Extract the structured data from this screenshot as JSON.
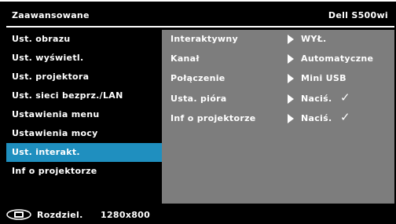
{
  "header": {
    "title": "Zaawansowane",
    "model": "Dell S500wi"
  },
  "sidebar": {
    "items": [
      {
        "label": "Ust. obrazu"
      },
      {
        "label": "Ust. wyświetl."
      },
      {
        "label": "Ust. projektora"
      },
      {
        "label": "Ust. sieci bezprz./LAN"
      },
      {
        "label": "Ustawienia menu"
      },
      {
        "label": "Ustawienia mocy"
      },
      {
        "label": "Ust. interakt.",
        "selected": true
      },
      {
        "label": "Inf o projektorze"
      }
    ]
  },
  "panel": {
    "rows": [
      {
        "label": "Interaktywny",
        "value": "WYŁ.",
        "icon": "arrow-right-icon"
      },
      {
        "label": "Kanał",
        "value": "Automatyczne",
        "icon": "arrow-right-icon"
      },
      {
        "label": "Połączenie",
        "value": "Mini USB",
        "icon": "arrow-right-icon"
      },
      {
        "label": "Usta. pióra",
        "value": "Naciś.",
        "check": "✓",
        "icon": "arrow-right-icon"
      },
      {
        "label": "Inf o projektorze",
        "value": "Naciś.",
        "check": "✓",
        "icon": "arrow-right-icon"
      }
    ]
  },
  "footer": {
    "resolution_label": "Rozdziel.",
    "resolution_value": "1280x800",
    "icon": "display-source-icon"
  },
  "colors": {
    "background": "#000000",
    "panel": "#7d7d7d",
    "selected": "#1f8fbf",
    "text": "#ffffff"
  }
}
